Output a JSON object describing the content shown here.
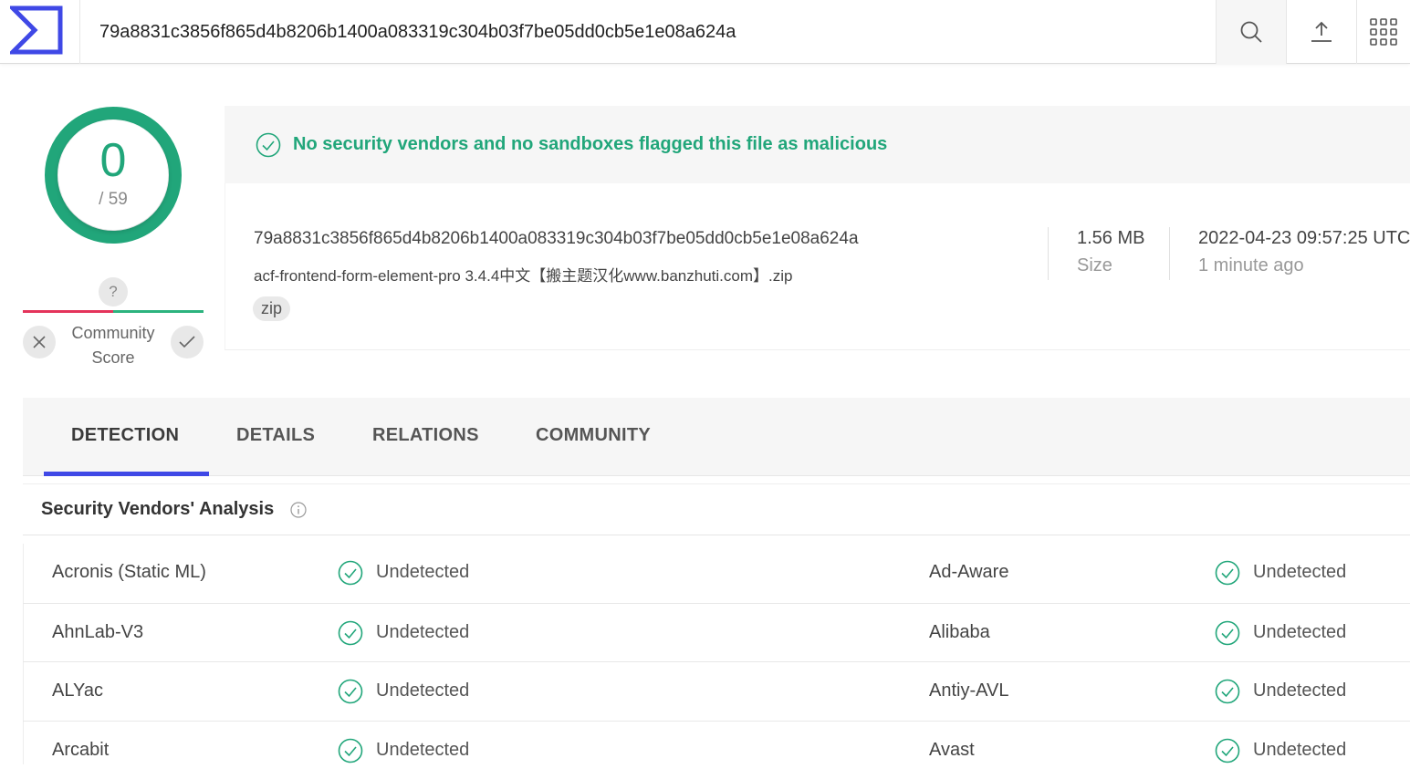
{
  "search": {
    "value": "79a8831c3856f865d4b8206b1400a083319c304b03f7be05dd0cb5e1e08a624a"
  },
  "topbar": {
    "icons": [
      "virustotal-logo-icon",
      "search-icon",
      "upload-icon",
      "apps-grid-icon"
    ]
  },
  "score": {
    "detections": "0",
    "total": "/ 59",
    "ring_color": "#21a67a"
  },
  "community": {
    "unknown_mark": "?",
    "label_line1": "Community",
    "label_line2": "Score"
  },
  "banner": {
    "message": "No security vendors and no sandboxes flagged this file as malicious",
    "color": "#21a67a"
  },
  "file": {
    "hash": "79a8831c3856f865d4b8206b1400a083319c304b03f7be05dd0cb5e1e08a624a",
    "name": "acf-frontend-form-element-pro 3.4.4中文【搬主题汉化www.banzhuti.com】.zip",
    "tag": "zip",
    "size_value": "1.56 MB",
    "size_label": "Size",
    "date_value": "2022-04-23 09:57:25 UTC",
    "date_label": "1 minute ago"
  },
  "tabs": [
    {
      "label": "DETECTION",
      "active": true
    },
    {
      "label": "DETAILS",
      "active": false
    },
    {
      "label": "RELATIONS",
      "active": false
    },
    {
      "label": "COMMUNITY",
      "active": false
    }
  ],
  "accent_color": "#3f48e6",
  "section": {
    "title": "Security Vendors' Analysis"
  },
  "vendors": [
    {
      "left_name": "Acronis (Static ML)",
      "left_result": "Undetected",
      "right_name": "Ad-Aware",
      "right_result": "Undetected"
    },
    {
      "left_name": "AhnLab-V3",
      "left_result": "Undetected",
      "right_name": "Alibaba",
      "right_result": "Undetected"
    },
    {
      "left_name": "ALYac",
      "left_result": "Undetected",
      "right_name": "Antiy-AVL",
      "right_result": "Undetected"
    },
    {
      "left_name": "Arcabit",
      "left_result": "Undetected",
      "right_name": "Avast",
      "right_result": "Undetected"
    }
  ]
}
